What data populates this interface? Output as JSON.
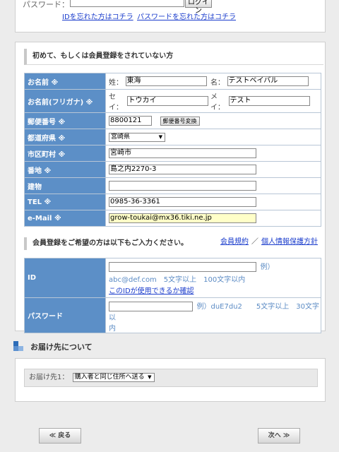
{
  "login": {
    "password_label": "パスワード：",
    "login_button": "ログイン",
    "forgot_id": "IDを忘れた方はコチラ",
    "forgot_password": "パスワードを忘れた方はコチラ"
  },
  "register": {
    "heading": "初めて、もしくは会員登録をされていない方",
    "name": {
      "label": "お名前 ※",
      "sei_label": "姓：",
      "sei_value": "東海",
      "mei_label": "名：",
      "mei_value": "テストベイバル"
    },
    "kana": {
      "label": "お名前(フリガナ) ※",
      "sei_label": "セイ：",
      "sei_value": "トウカイ",
      "mei_label": "メイ：",
      "mei_value": "テスト"
    },
    "zip": {
      "label": "郵便番号 ※",
      "value": "8800121",
      "button": "郵便番号変換"
    },
    "pref": {
      "label": "都道府県 ※",
      "value": "宮崎県"
    },
    "city": {
      "label": "市区町村 ※",
      "value": "宮崎市"
    },
    "address": {
      "label": "番地 ※",
      "value": "島之内2270-3"
    },
    "building": {
      "label": "建物",
      "value": ""
    },
    "tel": {
      "label": "TEL ※",
      "value": "0985-36-3361"
    },
    "email": {
      "label": "e-Mail ※",
      "value": "grow-toukai@mx36.tiki.ne.jp"
    },
    "terms_link": "会員規約",
    "privacy_link": "個人情報保護方針",
    "link_sep": "／",
    "member_heading": "会員登録をご希望の方は以下もご入力ください。",
    "id": {
      "label": "ID",
      "example": "例）",
      "hint": "abc@def.com　5文字以上　100文字以内",
      "check_link": "このIDが使用できるか確認"
    },
    "password": {
      "label": "パスワード",
      "hint_a": "例）duE7du2　　5文字以上　30文字以",
      "hint_b": "内"
    }
  },
  "delivery": {
    "title": "お届け先について",
    "dest_label": "お届け先1：",
    "dest_value": "購入者と同じ住所へ送る"
  },
  "nav": {
    "back": "≪ 戻る",
    "next": "次へ ≫"
  },
  "colors": {
    "label_bg": "#5c8fc7",
    "link": "#1a3ccc",
    "hint": "#5b8bc4",
    "email_bg": "#ffffc8"
  }
}
